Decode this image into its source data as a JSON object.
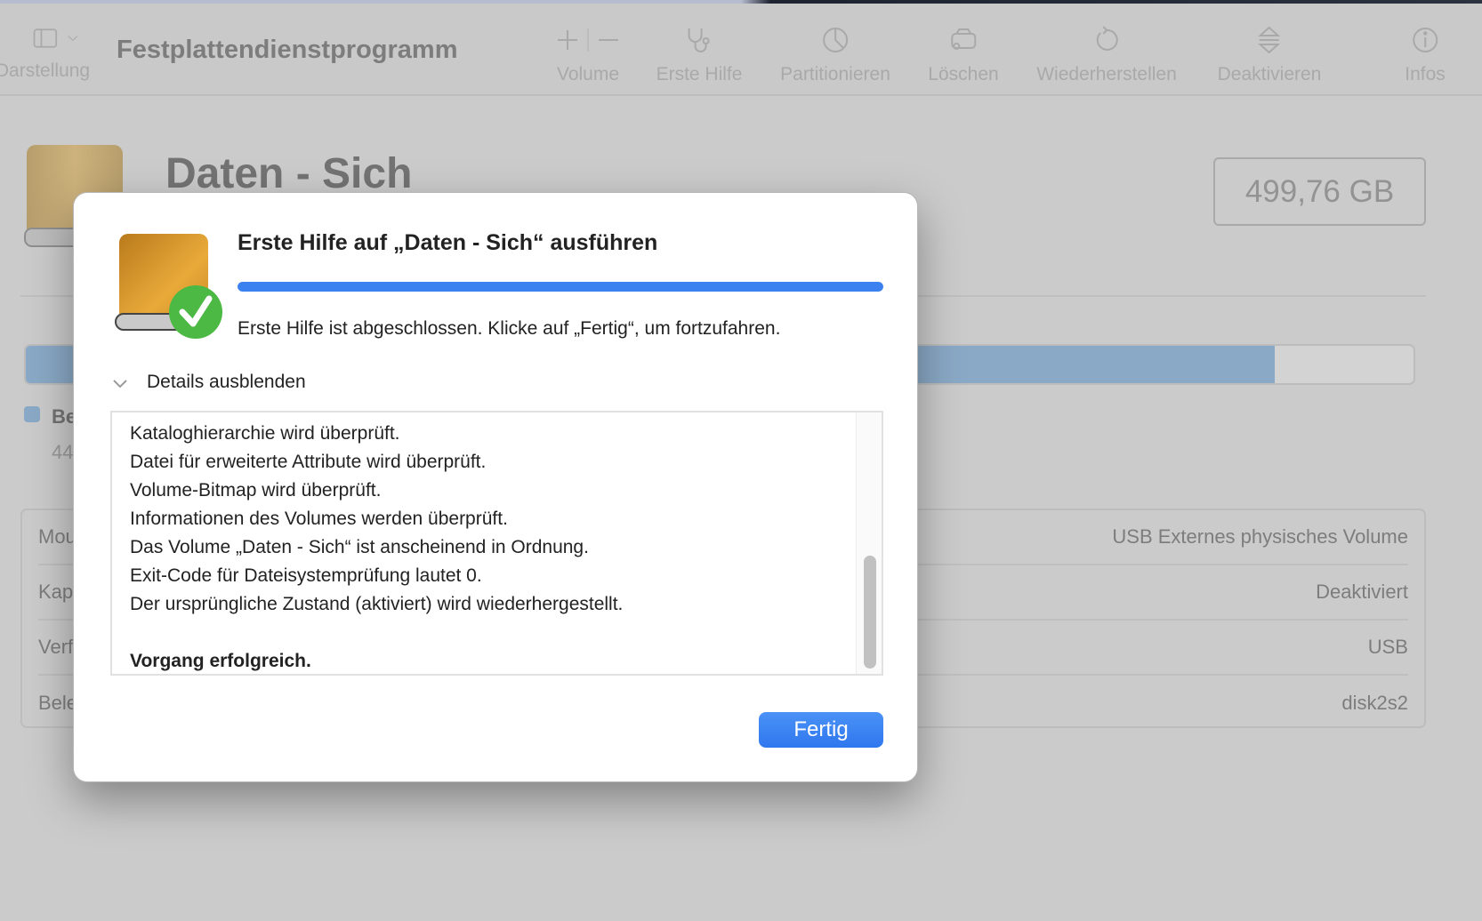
{
  "toolbar": {
    "view_label": "Darstellung",
    "app_title": "Festplattendienstprogramm",
    "items": [
      {
        "label": "Volume",
        "icon": "plus-minus-icon"
      },
      {
        "label": "Erste Hilfe",
        "icon": "stethoscope-icon"
      },
      {
        "label": "Partitionieren",
        "icon": "pie-chart-icon"
      },
      {
        "label": "Löschen",
        "icon": "erase-drive-icon"
      },
      {
        "label": "Wiederherstellen",
        "icon": "restore-icon"
      },
      {
        "label": "Deaktivieren",
        "icon": "eject-icon"
      },
      {
        "label": "Infos",
        "icon": "info-icon"
      }
    ]
  },
  "volume": {
    "title": "Daten - Sich",
    "capacity": "499,76 GB",
    "usage_fraction": 0.9,
    "legend_label": "Be",
    "legend_value": "44",
    "info_rows": [
      {
        "label": "Mou",
        "value": "USB Externes physisches Volume"
      },
      {
        "label": "Kap",
        "value": "Deaktiviert"
      },
      {
        "label": "Verf",
        "value": "USB"
      },
      {
        "label": "Bele",
        "value": "disk2s2"
      }
    ]
  },
  "dialog": {
    "title": "Erste Hilfe auf „Daten - Sich“ ausführen",
    "progress_percent": 100,
    "message": "Erste Hilfe ist abgeschlossen. Klicke auf „Fertig“, um fortzufahren.",
    "details_toggle": "Details ausblenden",
    "log_lines": [
      "Kataloghierarchie wird überprüft.",
      "Datei für erweiterte Attribute wird überprüft.",
      "Volume-Bitmap wird überprüft.",
      "Informationen des Volumes werden überprüft.",
      "Das Volume „Daten - Sich“ ist anscheinend in Ordnung.",
      "Exit-Code für Dateisystemprüfung lautet 0.",
      "Der ursprüngliche Zustand (aktiviert) wird wiederhergestellt.",
      "",
      "Vorgang erfolgreich."
    ],
    "done_button": "Fertig"
  },
  "colors": {
    "accent": "#3b82f0",
    "success": "#4cb944",
    "usage": "#8aa9c6"
  }
}
